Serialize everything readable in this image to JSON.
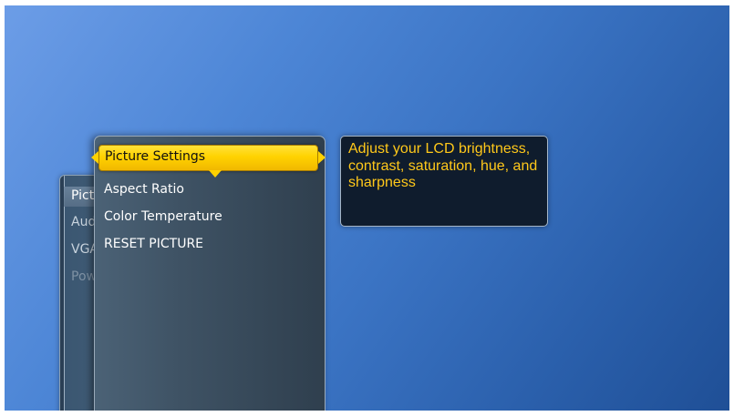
{
  "parent_menu": {
    "items": [
      {
        "label": "Picture",
        "state": "selected"
      },
      {
        "label": "Audio",
        "state": "normal"
      },
      {
        "label": "VGA Settings",
        "state": "normal"
      },
      {
        "label": "Power Consumption",
        "state": "dim"
      }
    ]
  },
  "picture_menu": {
    "selected_label": "Picture Settings",
    "items": [
      {
        "label": "Aspect Ratio"
      },
      {
        "label": "Color Temperature"
      },
      {
        "label": "RESET PICTURE"
      }
    ]
  },
  "info": {
    "text": "Adjust your LCD brightness, contrast, saturation, hue, and sharpness"
  },
  "colors": {
    "background": "#3b74c4",
    "selection": "#ffd200",
    "info_text": "#ffc81a",
    "info_bg": "#0f1c2d"
  }
}
